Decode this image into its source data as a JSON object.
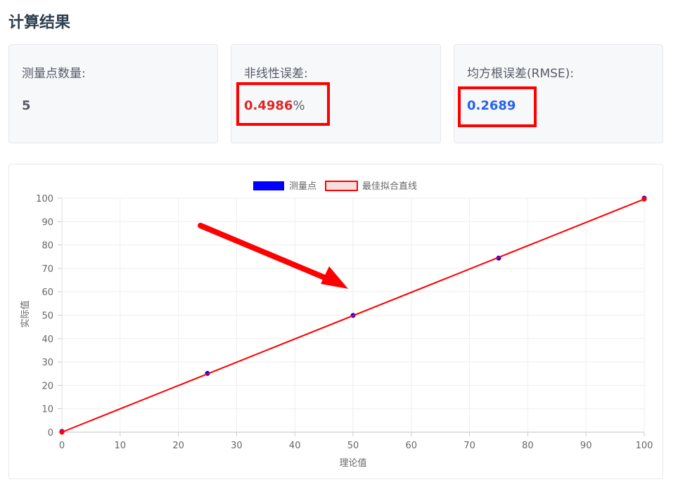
{
  "section_title": "计算结果",
  "cards": {
    "count": {
      "label": "测量点数量:",
      "value": "5"
    },
    "nonlinearity": {
      "label": "非线性误差:",
      "value": "0.4986",
      "unit": "%"
    },
    "rmse": {
      "label": "均方根误差(RMSE):",
      "value": "0.2689"
    }
  },
  "colors": {
    "measured": "#0000ff",
    "fit_line": "#ff0000",
    "highlight": "#ff0000",
    "value_red": "#dc2626",
    "value_blue": "#2563eb"
  },
  "chart_data": {
    "type": "scatter",
    "xlabel": "理论值",
    "ylabel": "实际值",
    "xlim": [
      0,
      100
    ],
    "ylim": [
      0,
      100
    ],
    "x_ticks": [
      "0",
      "10",
      "20",
      "30",
      "40",
      "50",
      "60",
      "70",
      "80",
      "90",
      "100"
    ],
    "y_ticks": [
      "0",
      "10",
      "20",
      "30",
      "40",
      "50",
      "60",
      "70",
      "80",
      "90",
      "100"
    ],
    "grid": true,
    "legend_position": "top-center",
    "series": [
      {
        "name": "测量点",
        "kind": "scatter",
        "points": [
          [
            0,
            0.3
          ],
          [
            25,
            25.1
          ],
          [
            50,
            49.9
          ],
          [
            75,
            74.4
          ],
          [
            100,
            100
          ]
        ]
      },
      {
        "name": "最佳拟合直线",
        "kind": "line",
        "points": [
          [
            0,
            0
          ],
          [
            100,
            99.6
          ]
        ]
      }
    ]
  }
}
